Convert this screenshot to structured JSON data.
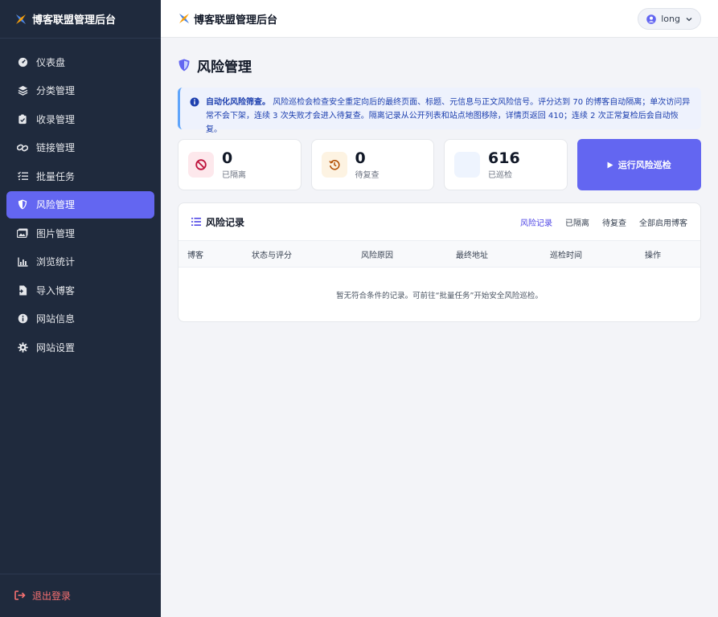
{
  "app": {
    "brand": "博客联盟管理后台"
  },
  "sidebar": {
    "items": [
      {
        "label": "仪表盘"
      },
      {
        "label": "分类管理"
      },
      {
        "label": "收录管理"
      },
      {
        "label": "链接管理"
      },
      {
        "label": "批量任务"
      },
      {
        "label": "风险管理"
      },
      {
        "label": "图片管理"
      },
      {
        "label": "浏览统计"
      },
      {
        "label": "导入博客"
      },
      {
        "label": "网站信息"
      },
      {
        "label": "网站设置"
      }
    ],
    "logout": "退出登录"
  },
  "topbar": {
    "title": "博客联盟管理后台",
    "user": "long"
  },
  "page": {
    "title": "风险管理",
    "alert_bold": "自动化风险筛查。",
    "alert_text": "风险巡检会检查安全重定向后的最终页面、标题、元信息与正文风险信号。评分达到 70 的博客自动隔离；单次访问异常不会下架，连续 3 次失败才会进入待复查。隔离记录从公开列表和站点地图移除，详情页返回 410；连续 2 次正常复检后会自动恢复。"
  },
  "stats": [
    {
      "value": "0",
      "label": "已隔离",
      "color": "#e11d48"
    },
    {
      "value": "0",
      "label": "待复查",
      "color": "#b45309"
    },
    {
      "value": "616",
      "label": "已巡检",
      "color": "#93c5fd"
    }
  ],
  "run_button": "运行风险巡检",
  "records": {
    "title": "风险记录",
    "tabs": [
      "风险记录",
      "已隔离",
      "待复查",
      "全部启用博客"
    ],
    "columns": [
      "博客",
      "状态与评分",
      "风险原因",
      "最终地址",
      "巡检时间",
      "操作"
    ],
    "empty": "暂无符合条件的记录。可前往“批量任务”开始安全风险巡检。"
  },
  "colors": {
    "accent": "#6366f1",
    "sidebar": "#1f2a3d",
    "logout": "#f87171"
  }
}
